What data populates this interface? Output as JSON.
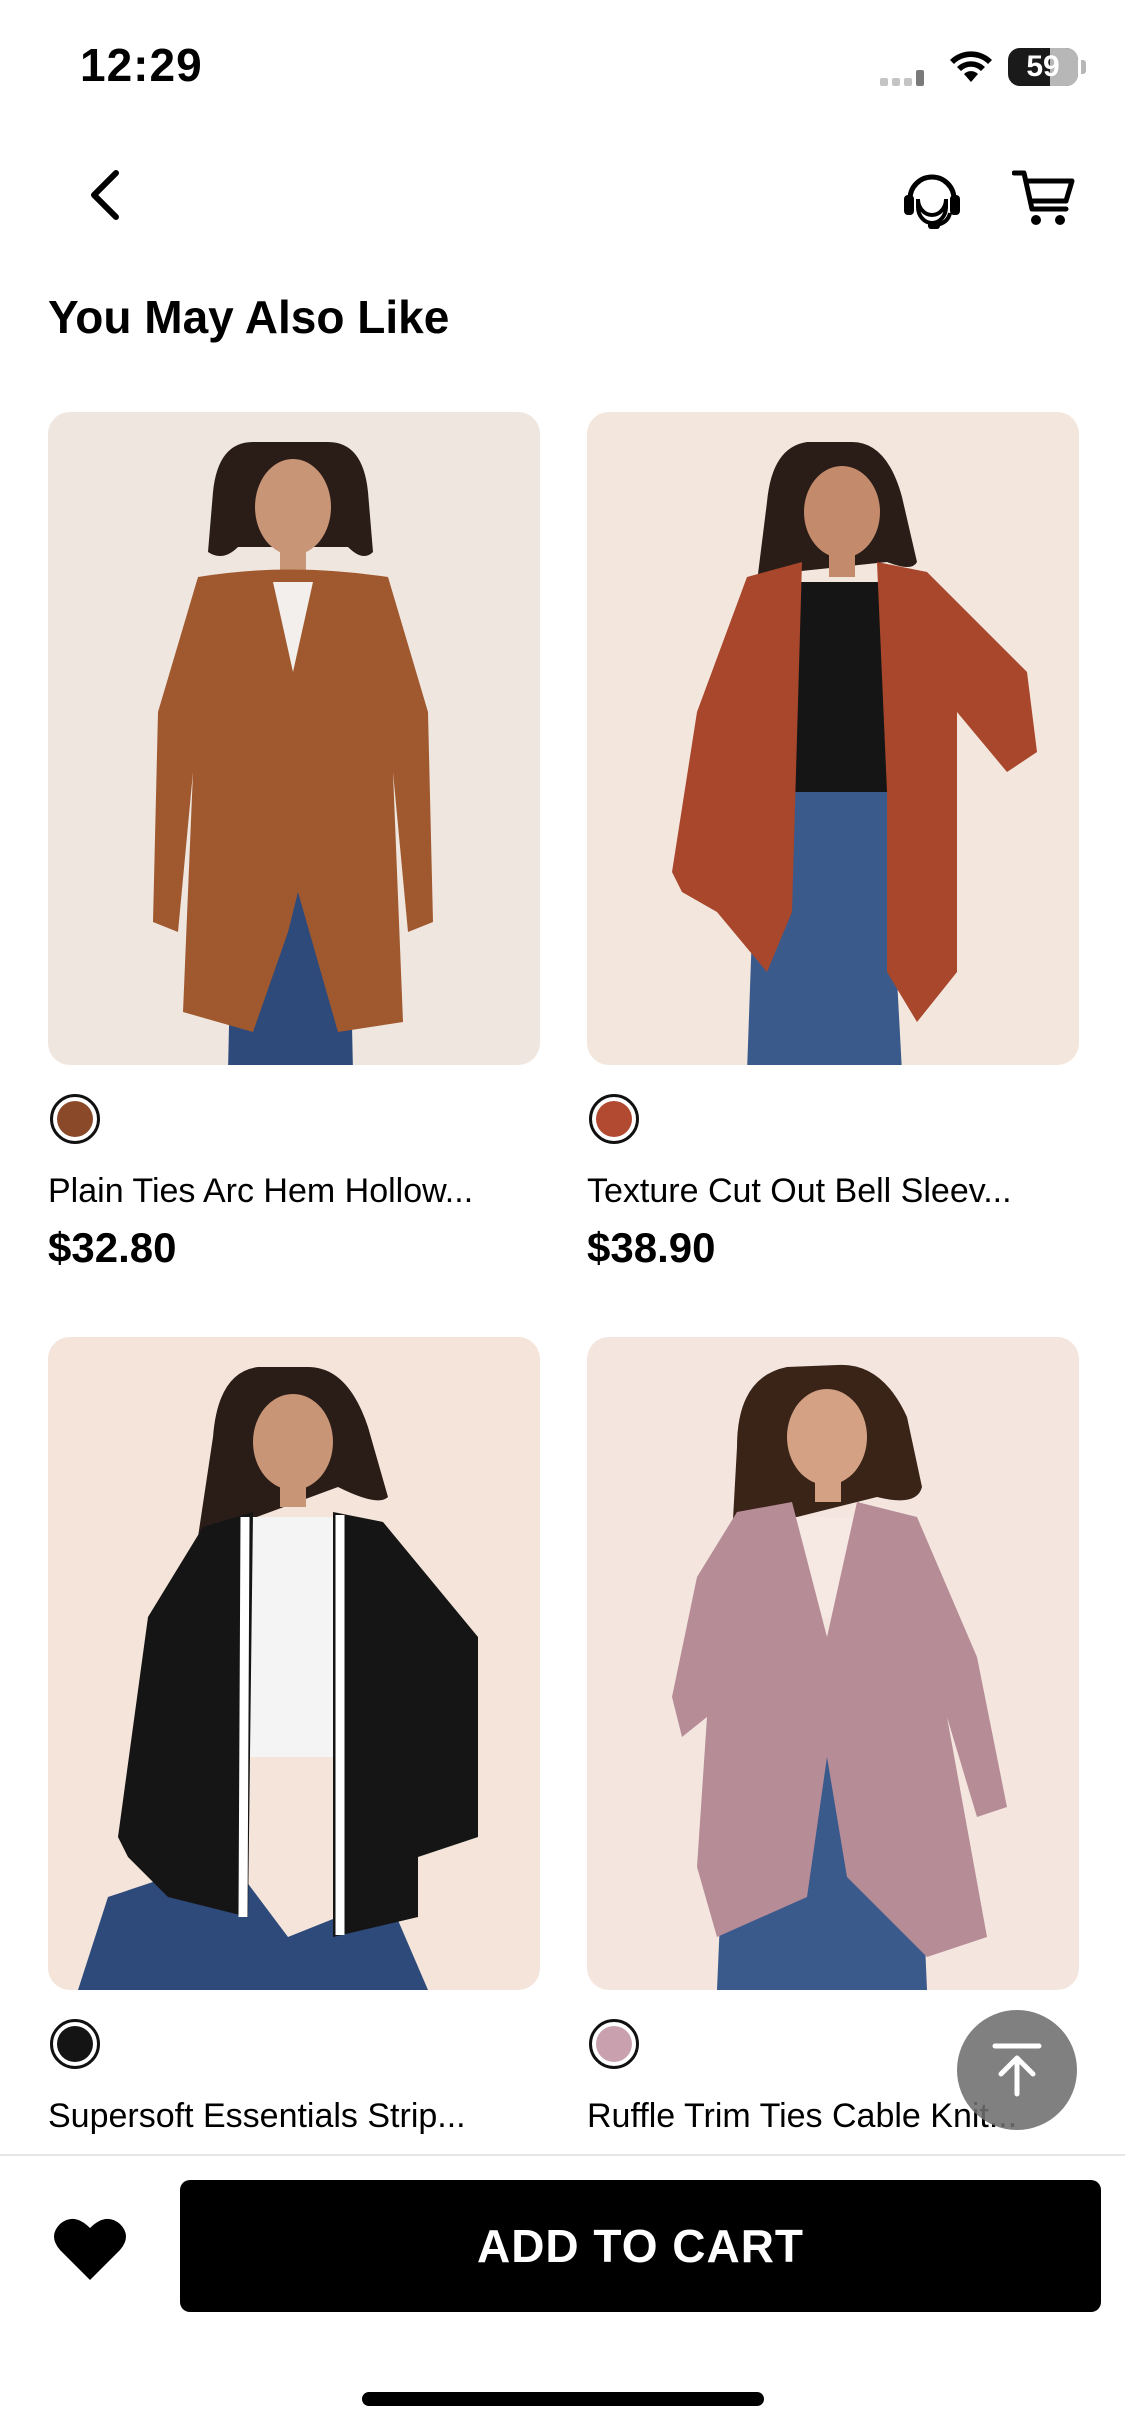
{
  "status_bar": {
    "time": "12:29",
    "battery": "59"
  },
  "nav": {
    "back_icon": "chevron-left-icon",
    "support_icon": "headset-support-icon",
    "cart_icon": "shopping-cart-icon"
  },
  "section": {
    "title": "You May Also Like"
  },
  "products": [
    {
      "name": "Plain Ties Arc Hem Hollow...",
      "price": "$32.80",
      "swatch_color": "#8a4a2a",
      "image_bg": "#efe6e0",
      "garment_color": "#a0592f"
    },
    {
      "name": "Texture Cut Out Bell Sleev...",
      "price": "$38.90",
      "swatch_color": "#b14a30",
      "image_bg": "#f3e6dc",
      "garment_color": "#a8472c"
    },
    {
      "name": "Supersoft Essentials Strip...",
      "price": "",
      "swatch_color": "#141414",
      "image_bg": "#f4e4da",
      "garment_color": "#151515"
    },
    {
      "name": "Ruffle Trim Ties Cable Knit...",
      "price": "",
      "swatch_color": "#c9a1ae",
      "image_bg": "#f4e6df",
      "garment_color": "#b68c97"
    }
  ],
  "back_to_top_icon": "arrow-up-to-top-icon",
  "bottom_bar": {
    "wishlist_icon": "heart-icon",
    "add_to_cart_label": "ADD TO CART"
  }
}
